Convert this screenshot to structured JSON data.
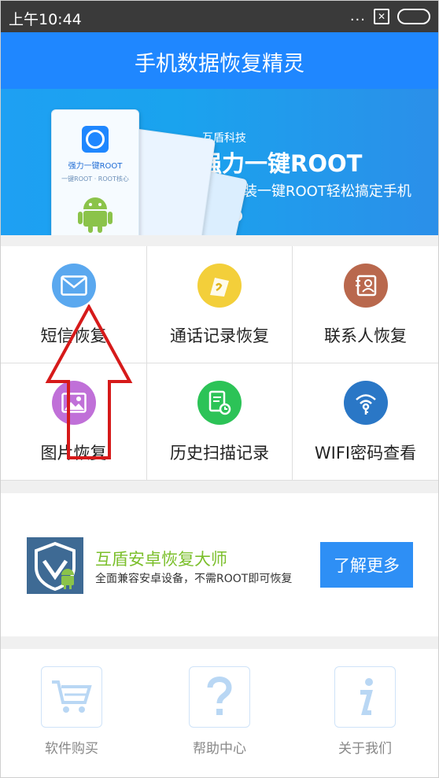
{
  "status_bar": {
    "time": "上午10:44",
    "dots": "...",
    "sim": "✕"
  },
  "header": {
    "title": "手机数据恢复精灵"
  },
  "banner": {
    "company": "互盾科技",
    "headline": "强力一键ROOT",
    "subline": "一键安装一键ROOT轻松搞定手机",
    "phone_app_label": "强力一键ROOT",
    "phone_app_sub": "一键ROOT · ROOT核心"
  },
  "features": [
    {
      "label": "短信恢复",
      "color": "#5aa8ef"
    },
    {
      "label": "通话记录恢复",
      "color": "#f3cf3a"
    },
    {
      "label": "联系人恢复",
      "color": "#b9684d"
    },
    {
      "label": "图片恢复",
      "color": "#c070d8"
    },
    {
      "label": "历史扫描记录",
      "color": "#2cc357"
    },
    {
      "label": "WIFI密码查看",
      "color": "#2a77c6"
    }
  ],
  "promo": {
    "name": "互盾安卓恢复大师",
    "desc": "全面兼容安卓设备，不需ROOT即可恢复",
    "button": "了解更多"
  },
  "bottom_nav": [
    {
      "label": "软件购买",
      "icon": "cart-icon"
    },
    {
      "label": "帮助中心",
      "icon": "question-icon"
    },
    {
      "label": "关于我们",
      "icon": "info-icon"
    }
  ],
  "colors": {
    "accent": "#1f87ff",
    "arrow": "#d61a1a",
    "promo_name": "#7bbf2b"
  }
}
